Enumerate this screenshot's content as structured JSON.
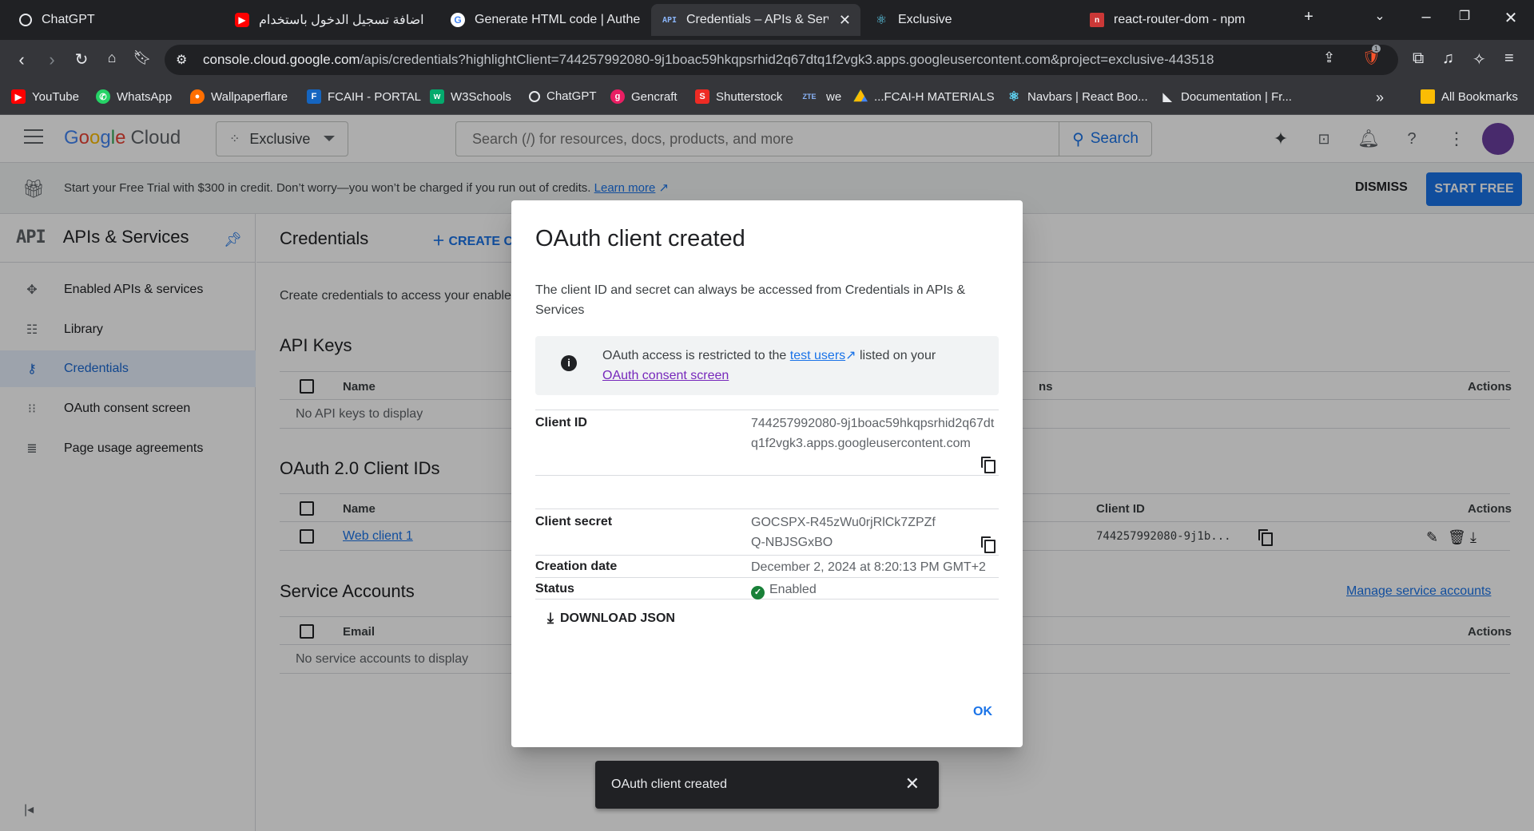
{
  "browser": {
    "tabs": [
      {
        "title": "ChatGPT",
        "icon": "chatgpt-icon"
      },
      {
        "title": "اضافة تسجيل الدخول باستخدام",
        "icon": "youtube-icon"
      },
      {
        "title": "Generate HTML code | Authen",
        "icon": "google-icon"
      },
      {
        "title": "Credentials – APIs & Servic",
        "icon": "api-icon"
      },
      {
        "title": "Exclusive",
        "icon": "react-icon"
      },
      {
        "title": "react-router-dom - npm",
        "icon": "npm-icon"
      }
    ],
    "url_host": "console.cloud.google.com",
    "url_path": "/apis/credentials?highlightClient=744257992080-9j1boac59hkqpsrhid2q67dtq1f2vgk3.apps.googleusercontent.com&project=exclusive-443518",
    "brave_badge": "1",
    "bookmarks": [
      {
        "label": "YouTube",
        "color": "#ff0000"
      },
      {
        "label": "WhatsApp",
        "color": "#25d366"
      },
      {
        "label": "Wallpaperflare",
        "color": "#ff6f00"
      },
      {
        "label": "FCAIH - PORTAL",
        "color": "#1565c0"
      },
      {
        "label": "W3Schools",
        "color": "#04aa6d"
      },
      {
        "label": "ChatGPT",
        "color": "#202124"
      },
      {
        "label": "Gencraft",
        "color": "#e91e63"
      },
      {
        "label": "Shutterstock",
        "color": "#ee2b24"
      },
      {
        "label": "we",
        "color": "#202124"
      },
      {
        "label": "...FCAI-H MATERIALS",
        "color": "#fbbc04"
      },
      {
        "label": "Navbars | React Boo...",
        "color": "#61dafb"
      },
      {
        "label": "Documentation | Fr...",
        "color": "#202124"
      }
    ],
    "all_bookmarks": "All Bookmarks"
  },
  "header": {
    "logo_google": "Google",
    "logo_cloud": "Cloud",
    "project": "Exclusive",
    "search_placeholder": "Search (/) for resources, docs, products, and more",
    "search_button": "Search"
  },
  "trial": {
    "text": "Start your Free Trial with $300 in credit. Don’t worry—you won’t be charged if you run out of credits.",
    "learn_more": "Learn more",
    "dismiss": "DISMISS",
    "start_free": "START FREE"
  },
  "sidebar": {
    "logo": "API",
    "title": "APIs & Services",
    "items": [
      {
        "label": "Enabled APIs & services",
        "icon": "diamond-nodes-icon"
      },
      {
        "label": "Library",
        "icon": "library-icon"
      },
      {
        "label": "Credentials",
        "icon": "key-icon"
      },
      {
        "label": "OAuth consent screen",
        "icon": "consent-icon"
      },
      {
        "label": "Page usage agreements",
        "icon": "settings-list-icon"
      }
    ]
  },
  "main": {
    "title": "Credentials",
    "create_label": "CREATE C",
    "description": "Create credentials to access your enable",
    "api_keys": {
      "heading": "API Keys",
      "col_name": "Name",
      "col_restrictions": "ns",
      "col_actions": "Actions",
      "empty": "No API keys to display"
    },
    "oauth": {
      "heading": "OAuth 2.0 Client IDs",
      "col_name": "Name",
      "col_client_id": "Client ID",
      "col_actions": "Actions",
      "row_name": "Web client 1",
      "row_client_id": "744257992080-9j1b..."
    },
    "service_accounts": {
      "heading": "Service Accounts",
      "manage_link": "Manage service accounts",
      "col_email": "Email",
      "col_actions": "Actions",
      "empty": "No service accounts to display"
    }
  },
  "dialog": {
    "title": "OAuth client created",
    "intro": "The client ID and secret can always be accessed from Credentials in APIs & Services",
    "notice_pre": "OAuth access is restricted to the",
    "notice_link1": "test users",
    "notice_mid": "listed on your",
    "notice_link2": "OAuth consent screen",
    "client_id_label": "Client ID",
    "client_id_value": "744257992080-9j1boac59hkqpsrhid2q67dtq1f2vgk3.apps.googleusercontent.com",
    "client_secret_label": "Client secret",
    "client_secret_value": "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",
    "creation_date_label": "Creation date",
    "creation_date_value": "December 2, 2024 at 8:20:13 PM GMT+2",
    "status_label": "Status",
    "status_value": "Enabled",
    "download_json": "DOWNLOAD JSON",
    "ok": "OK"
  },
  "snackbar": {
    "text": "OAuth client created"
  }
}
